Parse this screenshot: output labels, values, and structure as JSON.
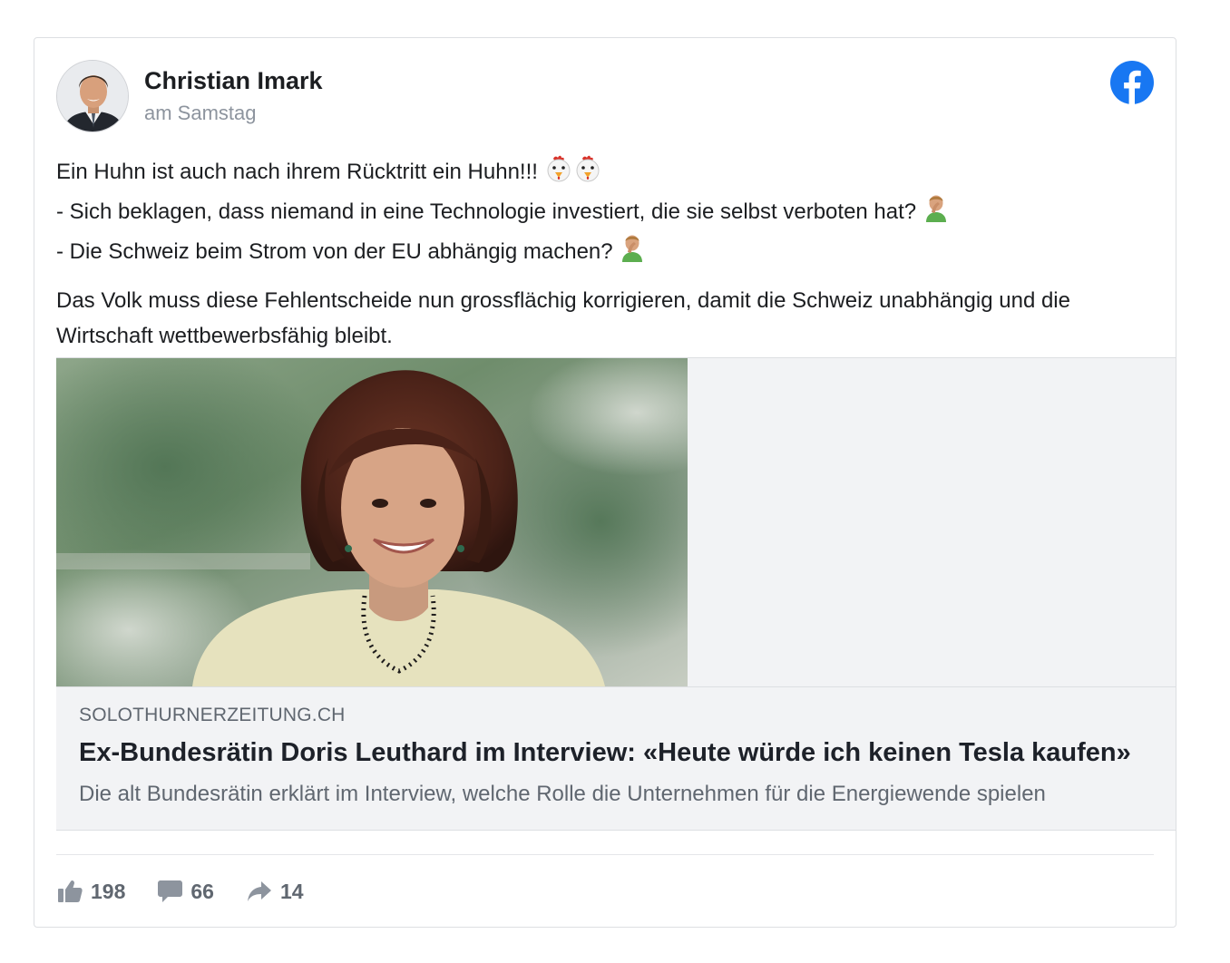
{
  "post": {
    "author": "Christian Imark",
    "timestamp": "am Samstag",
    "text": {
      "line1": "Ein Huhn ist auch nach ihrem Rücktritt ein Huhn!!!",
      "line2": "- Sich beklagen, dass niemand in eine Technologie investiert, die sie selbst verboten hat?",
      "line3": "- Die Schweiz beim Strom von der EU abhängig machen?",
      "paragraph2": "Das Volk muss diese Fehlentscheide nun grossflächig korrigieren, damit die Schweiz unabhängig und die Wirtschaft wettbewerbsfähig bleibt."
    },
    "emoji": {
      "line1": [
        "chicken-emoji",
        "chicken-emoji"
      ],
      "line2": "facepalm-emoji",
      "line3": "facepalm-emoji"
    }
  },
  "link_preview": {
    "domain": "SOLOTHURNERZEITUNG.CH",
    "headline": "Ex-Bundesrätin Doris Leuthard im Interview: «Heute würde ich keinen Tesla kaufen»",
    "description": "Die alt Bundesrätin erklärt im Interview, welche Rolle die Unternehmen für die Energiewende spielen"
  },
  "stats": {
    "likes": "198",
    "comments": "66",
    "shares": "14"
  },
  "colors": {
    "facebook_blue": "#1877f2",
    "meta_gray": "#606770",
    "timestamp_gray": "#8d949e",
    "preview_background": "#f2f3f5",
    "border": "#dddfe2"
  }
}
